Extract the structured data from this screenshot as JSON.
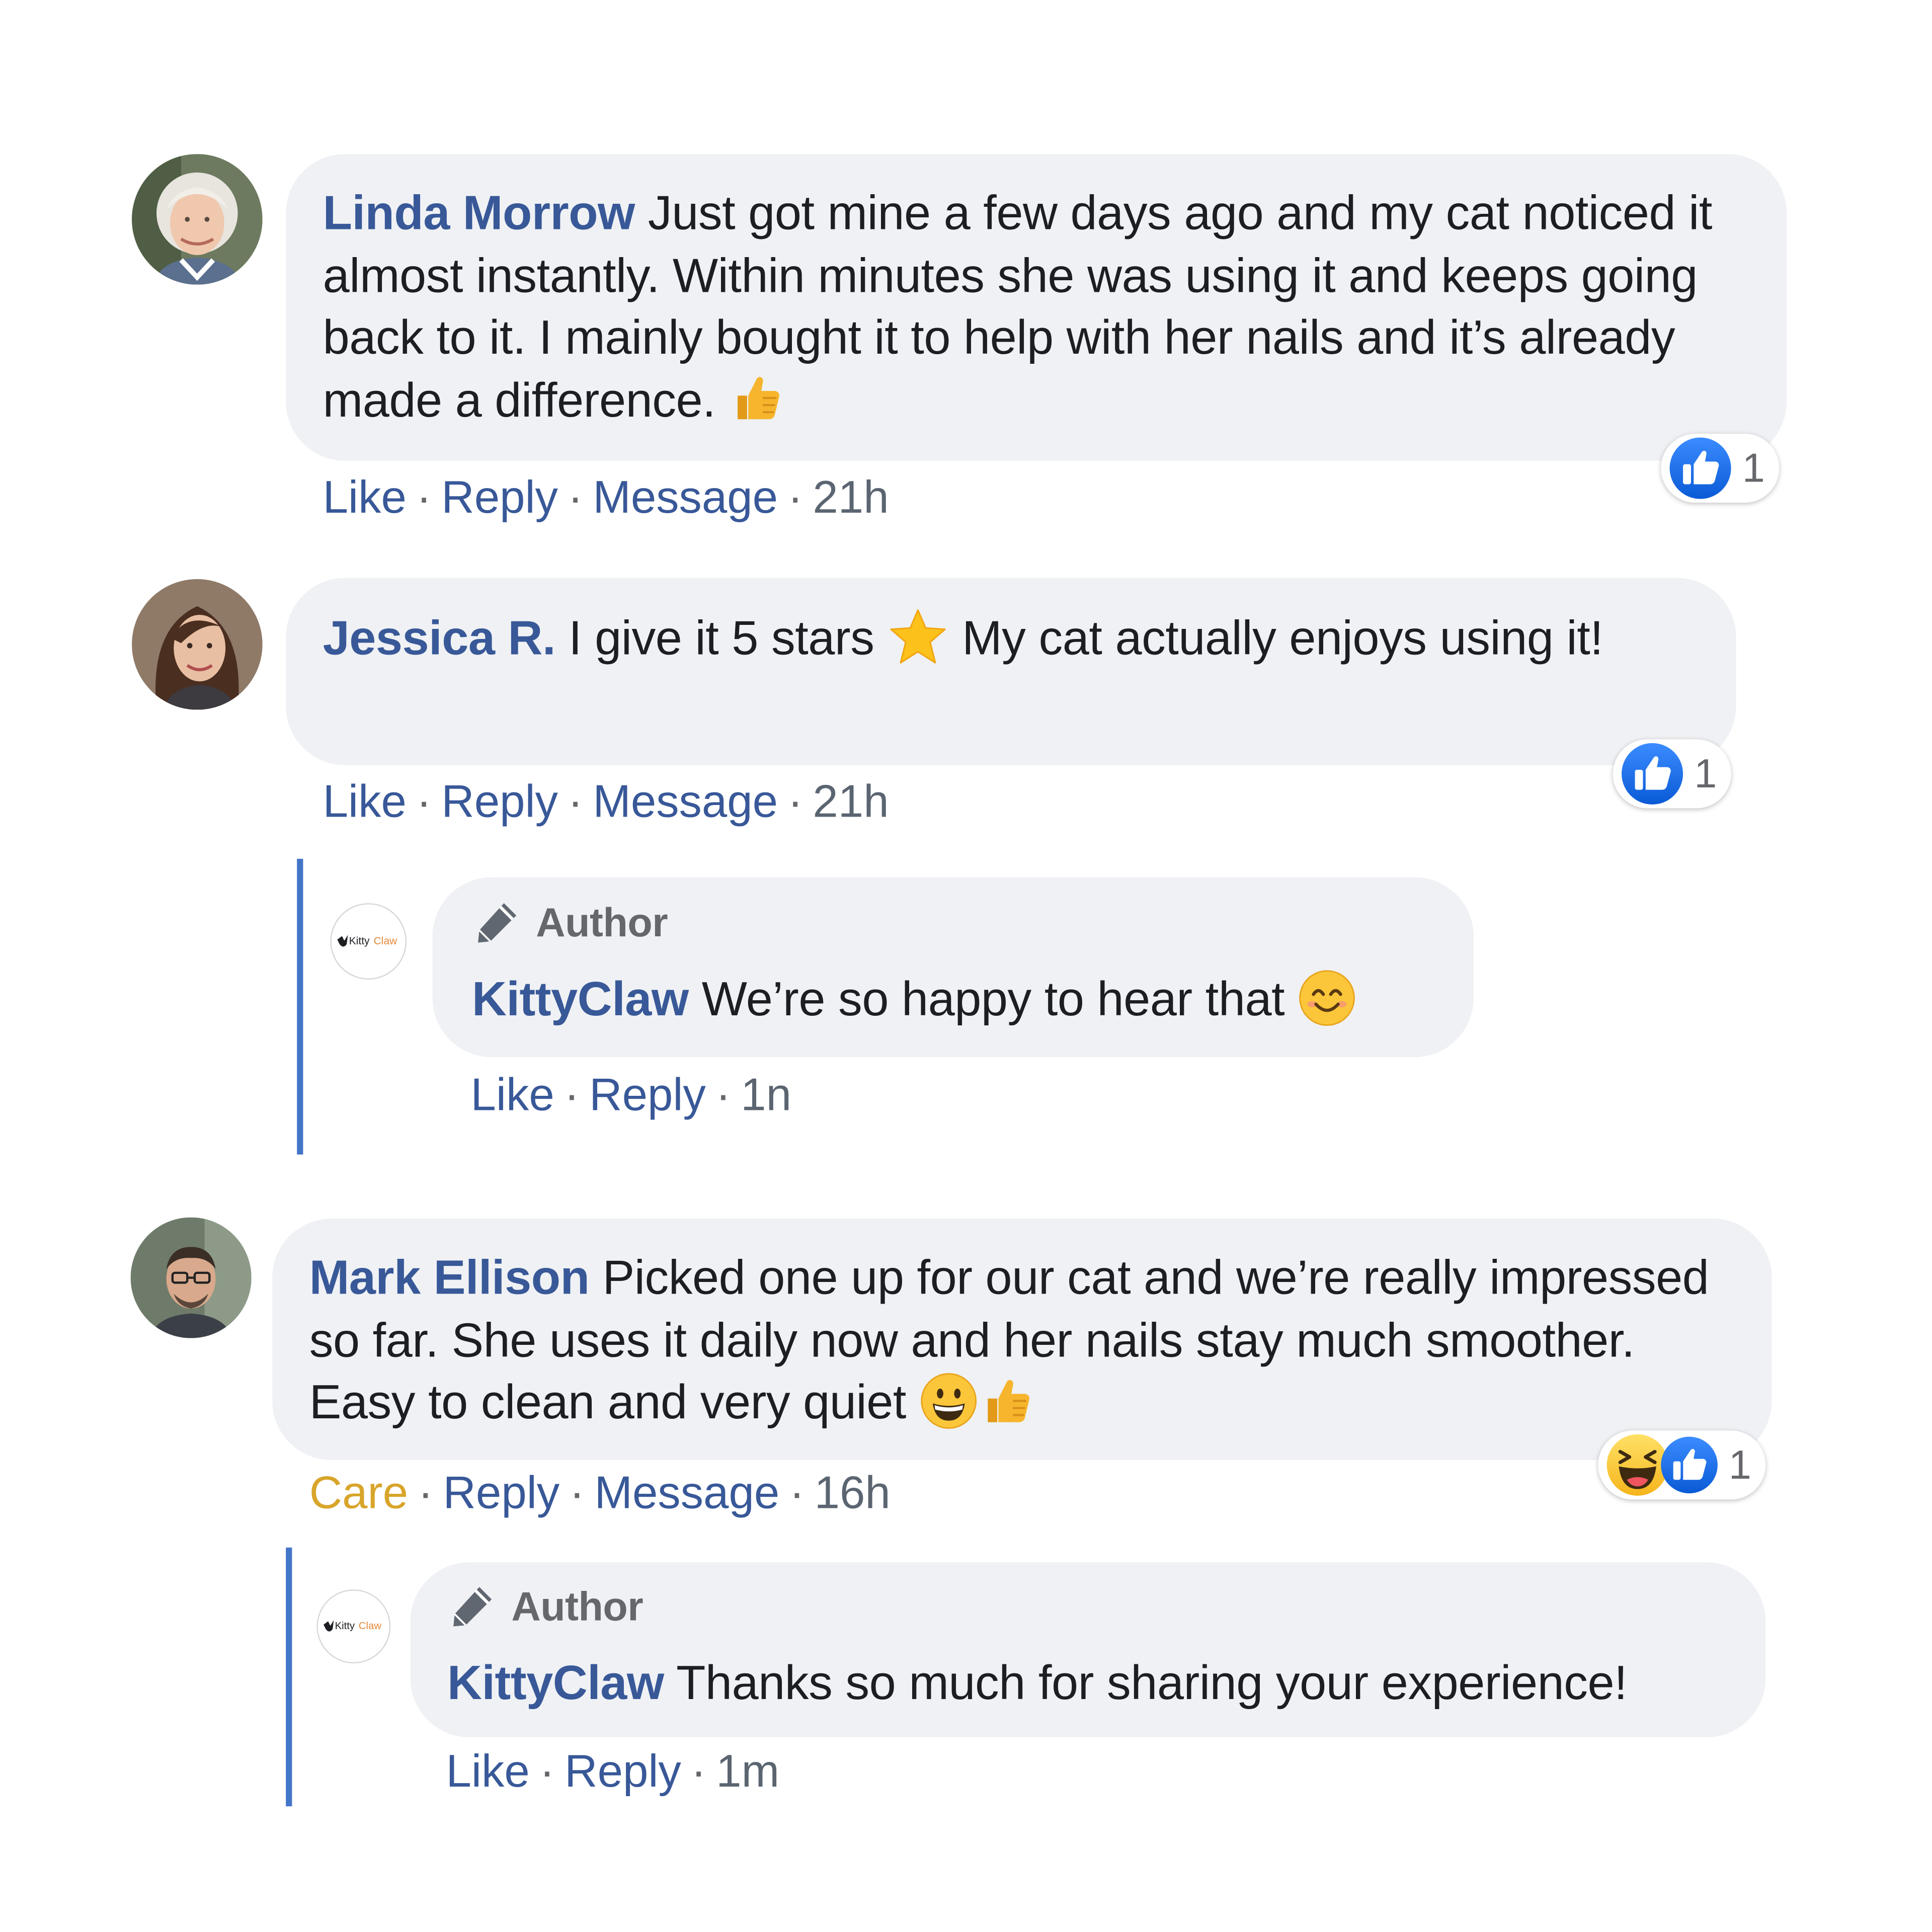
{
  "comments": [
    {
      "author": "Linda Morrow",
      "text": "Just got mine a few days ago and my cat noticed it almost instantly. Within minutes she was using it and keeps going back to it. I mainly bought it to help with her nails and it’s already made a difference.",
      "emoji_end": "thumbs-up-emoji",
      "actions": [
        "Like",
        "Reply",
        "Message"
      ],
      "time": "21h",
      "reaction_count": "1"
    },
    {
      "author": "Jessica R.",
      "text_before": "I give it 5 stars",
      "text_after": "My cat actually enjoys using it!",
      "emoji_mid": "star-emoji",
      "actions": [
        "Like",
        "Reply",
        "Message"
      ],
      "time": "21h",
      "reaction_count": "1",
      "reply": {
        "tag": "Author",
        "author": "KittyClaw",
        "text": "We’re so happy to hear that",
        "emoji_end": "smiling-face-emoji",
        "actions": [
          "Like",
          "Reply"
        ],
        "time": "1n",
        "logo_text_1": "Kitty",
        "logo_text_2": "Claw"
      }
    },
    {
      "author": "Mark Ellison",
      "text": "Picked one up for our cat and we’re really impressed so far. She uses it daily now and her nails stay much smoother. Easy to clean and very quiet",
      "emoji_end": [
        "grinning-face-emoji",
        "thumbs-up-emoji"
      ],
      "actions": [
        "Care",
        "Reply",
        "Message"
      ],
      "time": "16h",
      "reaction_count": "1",
      "reactions": [
        "laughing-emoji",
        "like-icon"
      ],
      "reply": {
        "tag": "Author",
        "author": "KittyClaw",
        "text": "Thanks so much for sharing your experience!",
        "actions": [
          "Like",
          "Reply"
        ],
        "time": "1m",
        "logo_text_1": "Kitty",
        "logo_text_2": "Claw"
      }
    }
  ],
  "colors": {
    "name": "#385898",
    "bubble": "#eff1f4",
    "care": "#d8a52a",
    "reply_line": "#4375c8",
    "like_blue": "#1877f2"
  }
}
